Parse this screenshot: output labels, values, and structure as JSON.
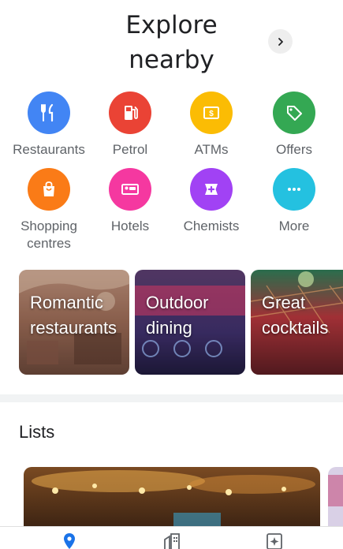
{
  "header": {
    "title_line1": "Explore",
    "title_line2": "nearby"
  },
  "categories": [
    {
      "label": "Restaurants",
      "icon": "fork-knife-icon",
      "color": "#4285f4"
    },
    {
      "label": "Petrol",
      "icon": "fuel-pump-icon",
      "color": "#ea4335"
    },
    {
      "label": "ATMs",
      "icon": "atm-icon",
      "color": "#fbbc04"
    },
    {
      "label": "Offers",
      "icon": "tag-icon",
      "color": "#34a853"
    },
    {
      "label": "Shopping centres",
      "icon": "shopping-bag-icon",
      "color": "#fa7b17"
    },
    {
      "label": "Hotels",
      "icon": "bed-icon",
      "color": "#f538a0"
    },
    {
      "label": "Chemists",
      "icon": "pharmacy-icon",
      "color": "#a142f4"
    },
    {
      "label": "More",
      "icon": "more-dots-icon",
      "color": "#24c1e0"
    }
  ],
  "collections": [
    {
      "label": "Romantic restaurants"
    },
    {
      "label": "Outdoor dining"
    },
    {
      "label": "Great cocktails"
    }
  ],
  "lists": {
    "title": "Lists"
  },
  "bottom_nav": [
    {
      "icon": "explore-pin-icon",
      "active": true,
      "color": "#1a73e8"
    },
    {
      "icon": "commute-building-icon",
      "active": false,
      "color": "#5f6368"
    },
    {
      "icon": "for-you-sparkle-icon",
      "active": false,
      "color": "#5f6368"
    }
  ]
}
